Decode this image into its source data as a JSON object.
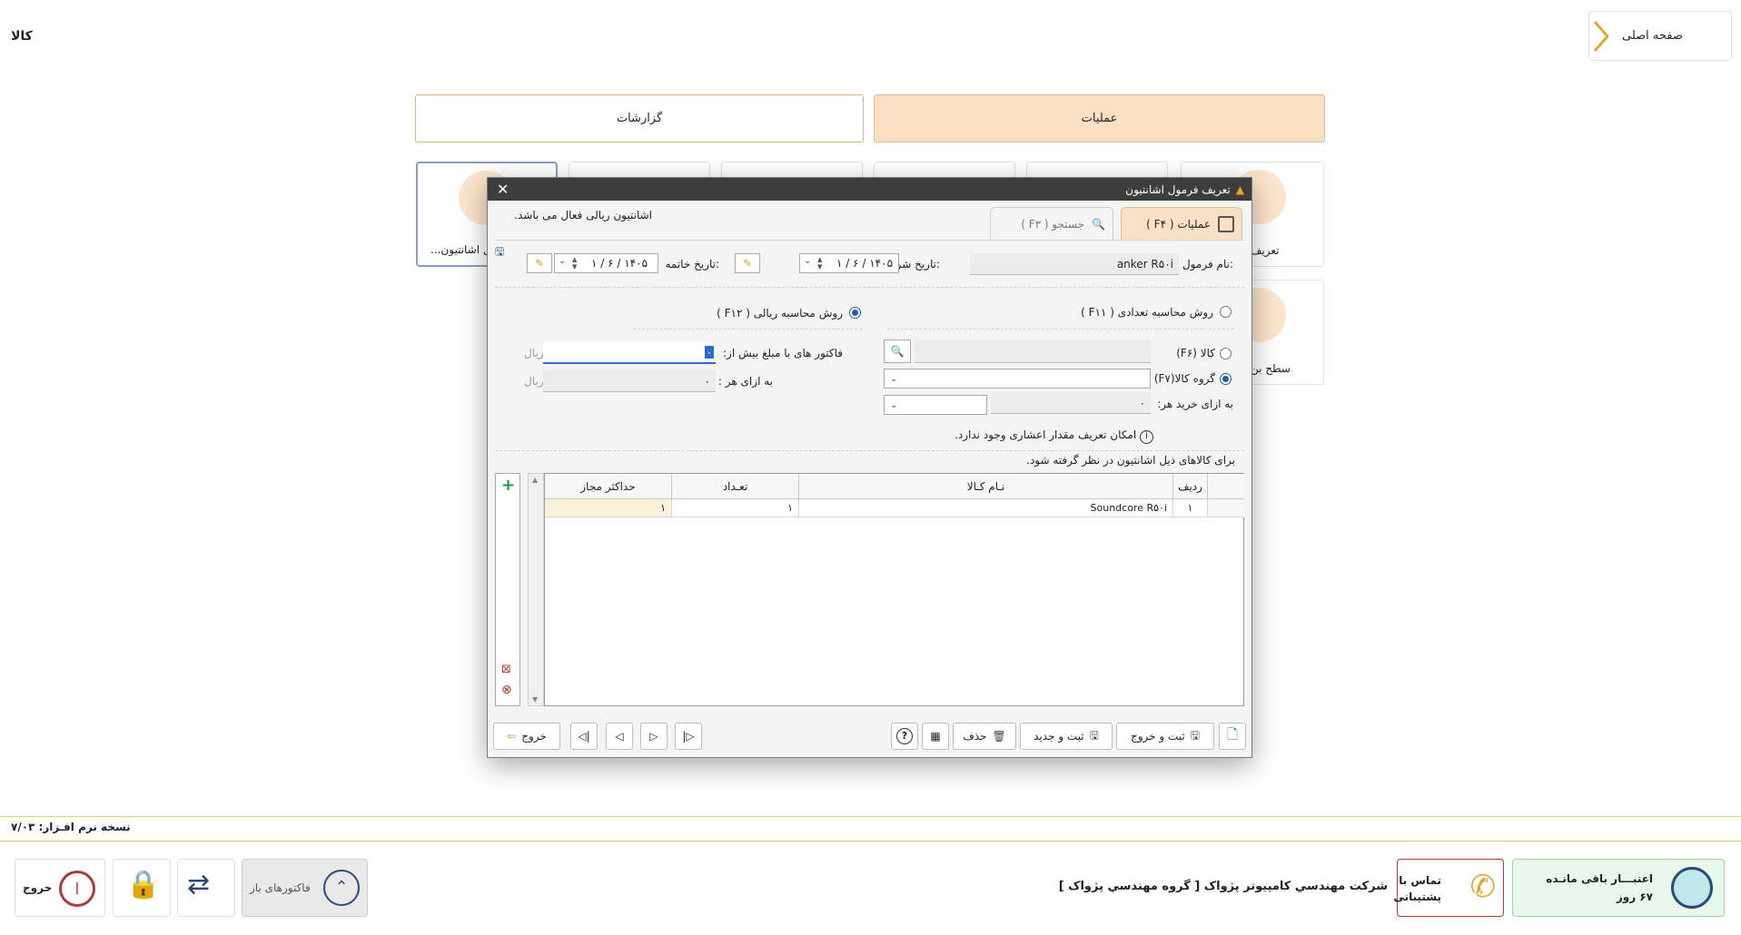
{
  "page": {
    "title": "کالا",
    "home": "صفحه اصلی"
  },
  "top_tabs": {
    "operations": "عملیات",
    "reports": "گزارشات"
  },
  "cards": {
    "left": "...ل اشانتیون",
    "right": "تعریف",
    "right2": "سطح بن"
  },
  "footer": {
    "version": "نسخه نرم افـزار: ۷/۰۳",
    "credit_line1": "اعتبـــار باقی مانـده",
    "credit_line2": "۶۷ روز",
    "support_line1": "تماس با",
    "support_line2": "پشتیبانی",
    "company": "شركت مهندسي كامپيوتر پژواک [ گروه مهندسي پژواک ]",
    "open_invoices": "فاکتورهای باز",
    "exit": "خروج"
  },
  "dialog": {
    "title": "تعریف فرمول اشانتیون",
    "status": "اشانتیون ریالی فعال می باشد.",
    "tab_ops": "عملیات  ( F۴ )",
    "tab_search": "جستجو  ( F۳ )",
    "formula_label": "نام فرمول:",
    "formula_value": "anker R۵۰i",
    "start_label": "تاریخ شروع:",
    "start_value": "۱ / ۶ / ۱۴۰۵",
    "end_label": "تاریخ خاتمه:",
    "end_value": "۱ / ۶ / ۱۴۰۵",
    "method_count": "روش محاسبه تعدادی  ( F۱۱ )",
    "method_rial": "روش محاسبه ریالی  ( F۱۲ )",
    "kala_radio": "کالا (F۶)",
    "group_radio": "گروه کالا(F۷)",
    "per_buy_label": "به ازای خرید هر:",
    "per_buy_value": "۰",
    "decimal_note": "امکان تعریف مقدار اعشاری وجود ندارد.",
    "invoice_amount_label": "فاکتور های با مبلغ بیش از:",
    "invoice_amount_value": "۰",
    "per_each_label": "به ازای هر :",
    "per_each_value": "۰",
    "currency": "ریال",
    "grid_caption": "برای کالاهای ذیل اشانتیون در نظر گرفته شود.",
    "grid": {
      "headers": {
        "row": "ردیف",
        "name": "نـام کـالا",
        "qty": "تعـداد",
        "max": "حداکثر مجاز"
      },
      "rows": [
        {
          "row": "۱",
          "name": "Soundcore R۵۰i",
          "qty": "۱",
          "max": "۱"
        }
      ]
    },
    "buttons": {
      "save_exit": "ثبت و خروج",
      "save_new": "ثبت و جدید",
      "delete": "حذف",
      "exit": "خروج"
    }
  }
}
